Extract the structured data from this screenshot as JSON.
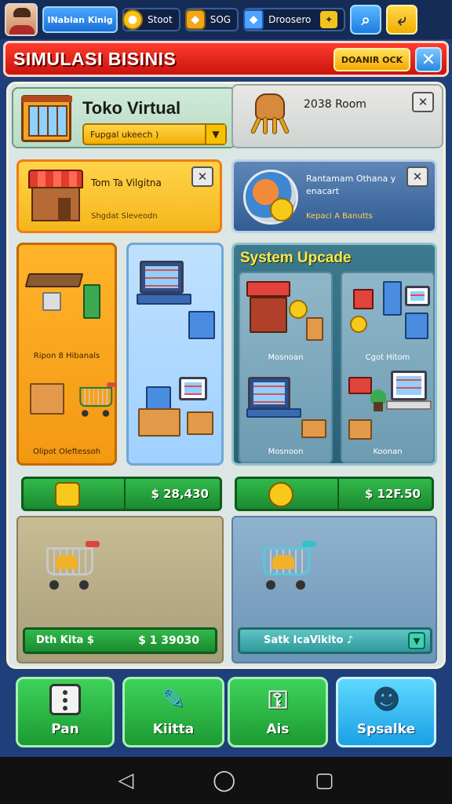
{
  "topbar": {
    "player_name": "INabian Kinig",
    "gold_value": "Stoot",
    "coin_value": "SOG",
    "gem_value": "Droosero",
    "search_icon": "search-icon",
    "exit_icon": "exit-icon"
  },
  "header": {
    "title": "SIMULASI BISINIS",
    "button_label": "DOANIR OCK",
    "close_icon": "close-icon"
  },
  "store": {
    "title": "Toko Virtual",
    "subtitle": "Fupgal ukeech )"
  },
  "item": {
    "title": "2038 Room"
  },
  "promo_left": {
    "title": "Tom Ta Vilgitna",
    "subtitle": "Shgdat Sleveodn"
  },
  "promo_right": {
    "title": "Rantamam Othana y enacart",
    "subtitle": "Kepaci A Banutts"
  },
  "categories": {
    "orange_top": "Ripon 8 Hibanals",
    "orange_bottom": "Olipot Oleftessoh",
    "system_title": "System Upcade",
    "sys_tile_left_top": "Mosnoan",
    "sys_tile_left_bottom": "Mosnoon",
    "sys_tile_right_top": "Cgot Hitom",
    "sys_tile_right_bottom": "Koonan"
  },
  "prices": {
    "left": "$ 28,430",
    "right": "$ 12F.50"
  },
  "carts": {
    "left_label": "Dth Kita $",
    "left_value": "$ 1 39030",
    "right_label": "Satk IcaVikito ♪"
  },
  "bottom_nav": {
    "btn1": "Pan",
    "btn2": "Kiitta",
    "btn3": "Ais",
    "btn4": "Spsalke"
  },
  "colors": {
    "header_red": "#e0231a",
    "accent_yellow": "#f5c21b",
    "panel_bg": "#dce6e4",
    "nav_green": "#2bb743",
    "nav_cyan": "#26b2ef"
  }
}
